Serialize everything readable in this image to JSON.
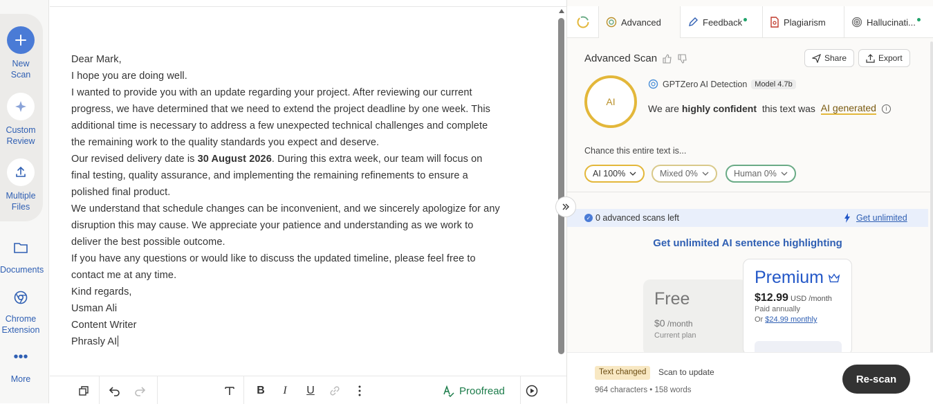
{
  "rail": {
    "new_scan": [
      "New",
      "Scan"
    ],
    "custom_review": [
      "Custom",
      "Review"
    ],
    "multiple_files": [
      "Multiple",
      "Files"
    ],
    "documents": "Documents",
    "chrome_extension": [
      "Chrome",
      "Extension"
    ],
    "more": "More"
  },
  "document": {
    "lines": [
      "Dear Mark,",
      "I hope you are doing well.",
      "I wanted to provide you with an update regarding your project. After reviewing our current",
      "progress, we have determined that we need to extend the project deadline by one week. This",
      "additional time is necessary to address a few unexpected technical challenges and complete",
      "the remaining work to the quality standards you expect and deserve."
    ],
    "delivery_prefix": "Our revised delivery date is ",
    "delivery_date": "30 August 2026",
    "delivery_suffix": ". During this extra week, our team will focus on",
    "lines2": [
      "final testing, quality assurance, and implementing the remaining refinements to ensure a",
      "polished final product.",
      "We understand that schedule changes can be inconvenient, and we sincerely apologize for any",
      "disruption this may cause. We appreciate your patience and understanding as we work to",
      "deliver the best possible outcome.",
      "If you have any questions or would like to discuss the updated timeline, please feel free to",
      "contact me at any time.",
      "Kind regards,",
      "Usman Ali",
      "Content Writer",
      "Phrasly AI"
    ]
  },
  "toolbar": {
    "proofread": "Proofread"
  },
  "tabs": {
    "advanced": "Advanced",
    "feedback": "Feedback",
    "plagiarism": "Plagiarism",
    "hallucination": "Hallucinati..."
  },
  "scan": {
    "title": "Advanced Scan",
    "share": "Share",
    "export": "Export",
    "ai_ring": "AI",
    "detector": "GPTZero AI Detection",
    "model": "Model 4.7b",
    "confidence_prefix": "We are ",
    "confidence_strong": "highly confident",
    "confidence_mid": " this text was ",
    "confidence_result": "AI generated",
    "chance_label": "Chance this entire text is...",
    "pill_ai": "AI 100%",
    "pill_mixed": "Mixed 0%",
    "pill_human": "Human 0%"
  },
  "banner": {
    "scans_left": "0 advanced scans left",
    "get_unlimited": "Get unlimited"
  },
  "upsell": {
    "headline": "Get unlimited AI sentence highlighting",
    "free_title": "Free",
    "free_price": "$0",
    "free_period": " /month",
    "free_sub": "Current plan",
    "premium_title": "Premium",
    "premium_price": "$12.99",
    "premium_period": " USD /month",
    "premium_billing": "Paid annually",
    "premium_or": "Or ",
    "premium_monthly": "$24.99 monthly"
  },
  "footer": {
    "text_changed": "Text changed",
    "scan_to_update": "Scan to update",
    "counts": "964 characters • 158 words",
    "rescan": "Re-scan"
  },
  "colors": {
    "accent_blue": "#2f5fb3",
    "ai_gold": "#e3b73a",
    "human_green": "#6aab86",
    "rescan_bg": "#333333"
  }
}
